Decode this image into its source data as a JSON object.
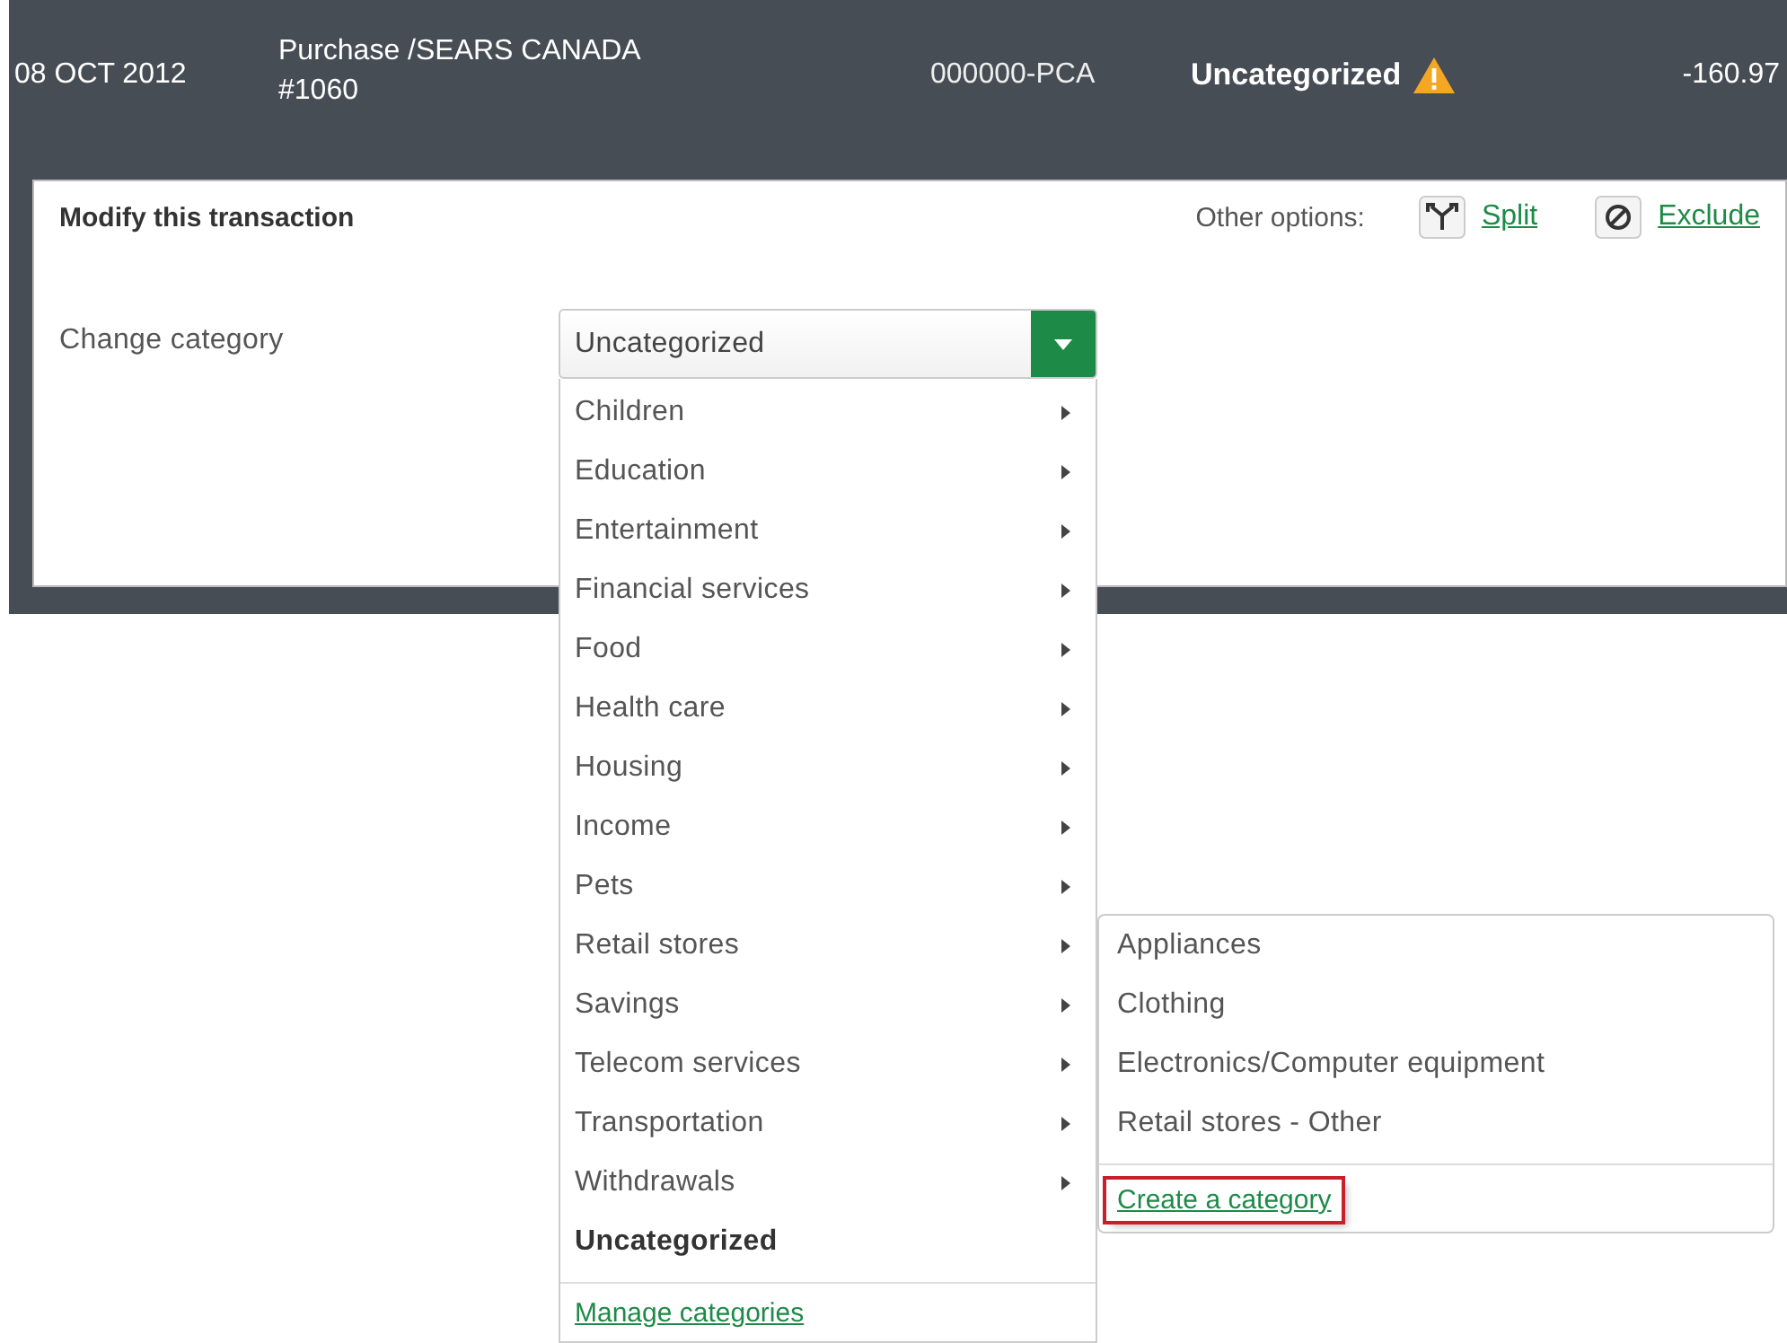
{
  "transaction": {
    "date": "08 OCT 2012",
    "description": "Purchase /SEARS CANADA #1060",
    "code": "000000-PCA",
    "category": "Uncategorized",
    "warning": true,
    "amount": "-160.97"
  },
  "panel": {
    "title": "Modify this transaction",
    "other_options_label": "Other options:",
    "options": [
      {
        "kind": "split",
        "label": "Split"
      },
      {
        "kind": "exclude",
        "label": "Exclude"
      }
    ],
    "change_label": "Change category",
    "select": {
      "value": "Uncategorized",
      "expanded": true
    }
  },
  "menu": {
    "items": [
      {
        "label": "Children",
        "kind": "group",
        "selected": false
      },
      {
        "label": "Education",
        "kind": "group",
        "selected": false
      },
      {
        "label": "Entertainment",
        "kind": "group",
        "selected": false
      },
      {
        "label": "Financial services",
        "kind": "group",
        "selected": false
      },
      {
        "label": "Food",
        "kind": "group",
        "selected": false
      },
      {
        "label": "Health care",
        "kind": "group",
        "selected": false
      },
      {
        "label": "Housing",
        "kind": "group",
        "selected": false
      },
      {
        "label": "Income",
        "kind": "group",
        "selected": false
      },
      {
        "label": "Pets",
        "kind": "group",
        "selected": false
      },
      {
        "label": "Retail stores",
        "kind": "group",
        "selected": false,
        "expanded": true,
        "children": [
          {
            "label": "Appliances"
          },
          {
            "label": "Clothing"
          },
          {
            "label": "Electronics/Computer equipment"
          },
          {
            "label": "Retail stores - Other"
          }
        ],
        "footer_link": {
          "label": "Create a category",
          "highlighted": true
        }
      },
      {
        "label": "Savings",
        "kind": "group",
        "selected": false
      },
      {
        "label": "Telecom services",
        "kind": "group",
        "selected": false
      },
      {
        "label": "Transportation",
        "kind": "group",
        "selected": false
      },
      {
        "label": "Withdrawals",
        "kind": "group",
        "selected": false
      },
      {
        "label": "Uncategorized",
        "kind": "leaf",
        "selected": true
      }
    ],
    "footer_link": {
      "label": "Manage categories"
    }
  }
}
